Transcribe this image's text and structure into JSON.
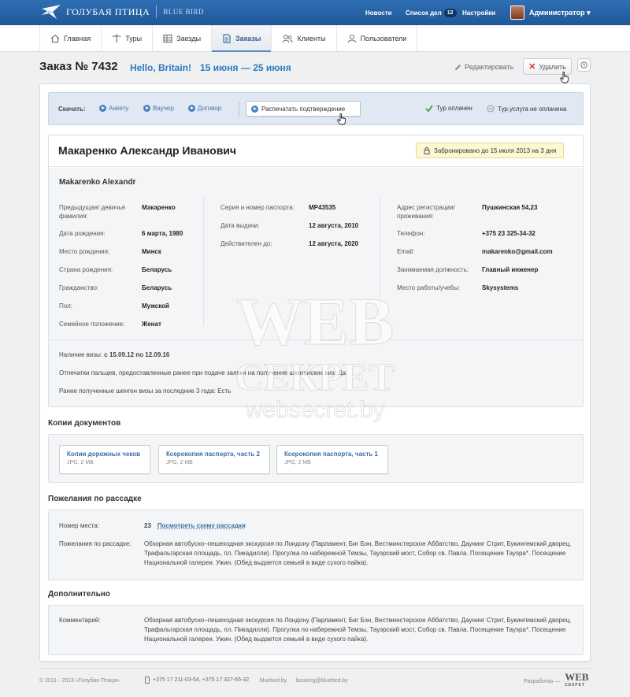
{
  "brand": {
    "title": "ГОЛУБАЯ ПТИЦА",
    "subtitle": "BLUE BIRD"
  },
  "topnav": {
    "news": "Новости",
    "tasks": "Список дел",
    "tasks_count": "12",
    "settings": "Настройки",
    "user": "Администратор ▾"
  },
  "mainnav": [
    {
      "label": "Главная",
      "icon": "home-icon"
    },
    {
      "label": "Туры",
      "icon": "palm-icon"
    },
    {
      "label": "Заезды",
      "icon": "grid-icon"
    },
    {
      "label": "Заказы",
      "icon": "document-icon",
      "active": true
    },
    {
      "label": "Клиенты",
      "icon": "users-icon"
    },
    {
      "label": "Пользователи",
      "icon": "user-icon"
    }
  ],
  "order": {
    "title": "Заказ № 7432",
    "client": "Hello, Britain!",
    "dates": "15 июня — 25 июня",
    "edit": "Редактировать",
    "delete": "Удалить"
  },
  "download": {
    "label": "Скачать:",
    "links": [
      "Анкету",
      "Ваучер",
      "Договор"
    ],
    "print": "Распечатать подтверждение",
    "paid": "Тур оплачен",
    "not_paid": "Тур.услуга не оплачена"
  },
  "person": {
    "name": "Макаренко Александр Иванович",
    "booked": "Забронировано до 15 июля 2013 на 3 дня",
    "latin": "Makarenko Alexandr",
    "col1": [
      {
        "label": "Предыдущая/ девичья фамилия:",
        "value": "Макаренко"
      },
      {
        "label": "Дата рождения:",
        "value": "6 марта, 1980"
      },
      {
        "label": "Место рождения:",
        "value": "Минск"
      },
      {
        "label": "Страна рождения:",
        "value": "Беларусь"
      },
      {
        "label": "Гражданство:",
        "value": "Беларусь"
      },
      {
        "label": "Пол:",
        "value": "Мужской"
      },
      {
        "label": "Семейное положение:",
        "value": "Женат"
      }
    ],
    "col2": [
      {
        "label": "Серия и номер паспорта:",
        "value": "МР43535"
      },
      {
        "label": "Дата выдачи:",
        "value": "12 августа, 2010"
      },
      {
        "label": "Действителен до:",
        "value": "12 августа, 2020"
      }
    ],
    "col3": [
      {
        "label": "Адрес регистрации/ проживания:",
        "value": "Пушкинская 54,23"
      },
      {
        "label": "Телефон:",
        "value": "+375 23 325-34-32"
      },
      {
        "label": "Email:",
        "value": "makarenko@gmail.com"
      },
      {
        "label": "Занимаемая должность:",
        "value": "Главный инженер"
      },
      {
        "label": "Место работы/учебы:",
        "value": "Skysystems"
      }
    ],
    "visa_label": "Наличие визы:",
    "visa_value": "с 15.09.12 по 12.09.16",
    "fingerprints": "Отпечатки пальцев, предоставленные ранее при подаче заявки на получение шенгенских виз: Да",
    "schengen": "Ранее полученные шенген визы за последние 3 года: Есть"
  },
  "documents": {
    "title": "Копии документов",
    "items": [
      {
        "name": "Копии дорожных чеков",
        "meta": "JPG, 2 MB"
      },
      {
        "name": "Ксерокопия паспорта, часть 2",
        "meta": "JPG, 2 MB"
      },
      {
        "name": "Ксерокопия паспорта, часть 1",
        "meta": "JPG, 2 MB"
      }
    ]
  },
  "seating": {
    "title": "Пожелания по рассадке",
    "seat_label": "Номер места:",
    "seat_value": "23",
    "seat_link": "Посмотреть схему рассадки",
    "wish_label": "Пожелания по рассадке:",
    "wish_text": "Обзорная автобусно–пешеходная экскурсия по Лондону (Парламент, Биг Бэн, Вестминстерское Аббатство, Даунинг Стрит, Букингемский дворец, Трафальгарская площадь, пл. Пикадилли). Прогулка по набережной Темзы, Тауэрский мост, Собор св. Павла. Посещение Тауэра*. Посещение  Национальной галереи. Ужин. (Обед выдается семьей в виде сухого пайка)."
  },
  "extra": {
    "title": "Дополнительно",
    "comment_label": "Комментарий:",
    "comment_text": "Обзорная автобусно–пешеходная экскурсия по Лондону (Парламент, Биг Бэн, Вестминстерское Аббатство, Даунинг Стрит, Букингемский дворец, Трафальгарская площадь, пл. Пикадилли). Прогулка по набережной Темзы, Тауэрский мост, Собор св. Павла. Посещение Тауэра*. Посещение  Национальной галереи. Ужин. (Обед выдается семьей в виде сухого пайка)."
  },
  "watermark": {
    "line1": "WEB",
    "line2": "СЕКРЕТ",
    "line3": "websecret.by"
  },
  "footer": {
    "copyright": "© 2011 - 2013 «Голубая Птица»",
    "phones": "+375 17 211-03-54, +375 17 327-65-32",
    "site": "bluebird.by",
    "email": "booking@bluebird.by",
    "dev": "Разработка —",
    "dev_logo": "WEB",
    "dev_logo_sub": "СЕКРЕТ"
  }
}
